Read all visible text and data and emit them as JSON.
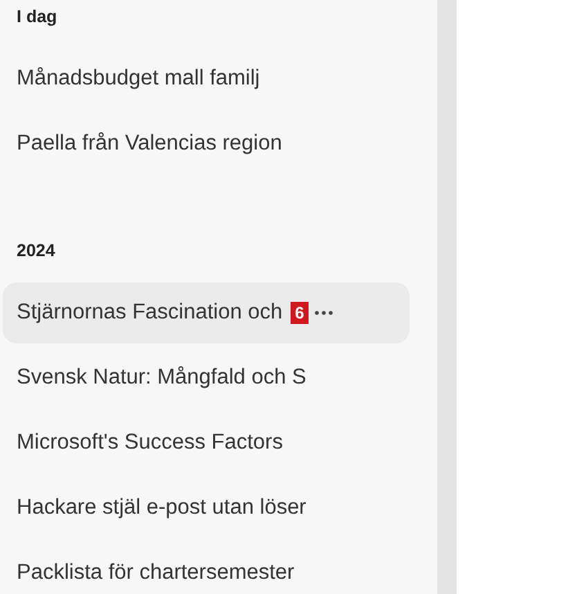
{
  "sidebar": {
    "groups": [
      {
        "heading": "I dag",
        "items": [
          {
            "title": "Månadsbudget mall familj",
            "selected": false
          },
          {
            "title": "Paella från Valencias region",
            "selected": false
          }
        ]
      },
      {
        "heading": "2024",
        "items": [
          {
            "title": "Stjärnornas Fascination och",
            "selected": true,
            "badge": "6"
          },
          {
            "title": "Svensk Natur: Mångfald och S",
            "selected": false
          },
          {
            "title": "Microsoft's Success Factors",
            "selected": false
          },
          {
            "title": "Hackare stjäl e-post utan löser",
            "selected": false
          },
          {
            "title": "Packlista för chartersemester",
            "selected": false
          }
        ]
      }
    ]
  }
}
